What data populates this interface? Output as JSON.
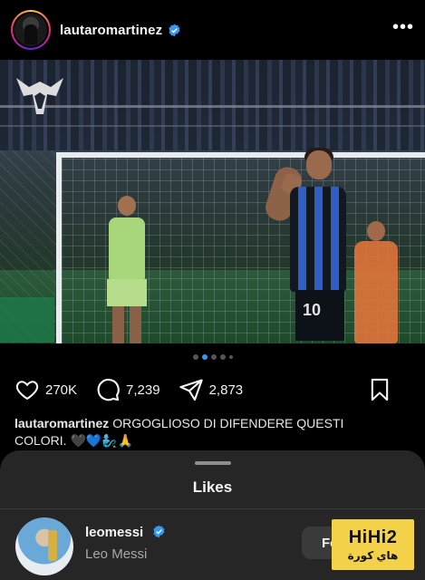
{
  "post": {
    "username": "lautaromartinez",
    "verified": true,
    "more_label": "•••"
  },
  "media": {
    "carousel_count": 5,
    "active_index": 1
  },
  "actions": {
    "likes": "270K",
    "comments": "7,239",
    "shares": "2,873"
  },
  "caption": {
    "username": "lautaromartinez",
    "text": "ORGOGLIOSO DI DIFENDERE QUESTI COLORI. 🖤💙🧞‍♂️🙏"
  },
  "photo": {
    "jersey_number": "10"
  },
  "likes_sheet": {
    "title": "Likes",
    "rows": [
      {
        "username": "leomessi",
        "name": "Leo Messi",
        "verified": true,
        "button": "Follow"
      }
    ]
  },
  "watermark": {
    "main": "HiHi2",
    "sub": "هاي كورة"
  },
  "colors": {
    "background": "#000000",
    "verified_blue": "#3897f0",
    "sheet": "#262626",
    "watermark_yellow": "#f3d24a"
  }
}
